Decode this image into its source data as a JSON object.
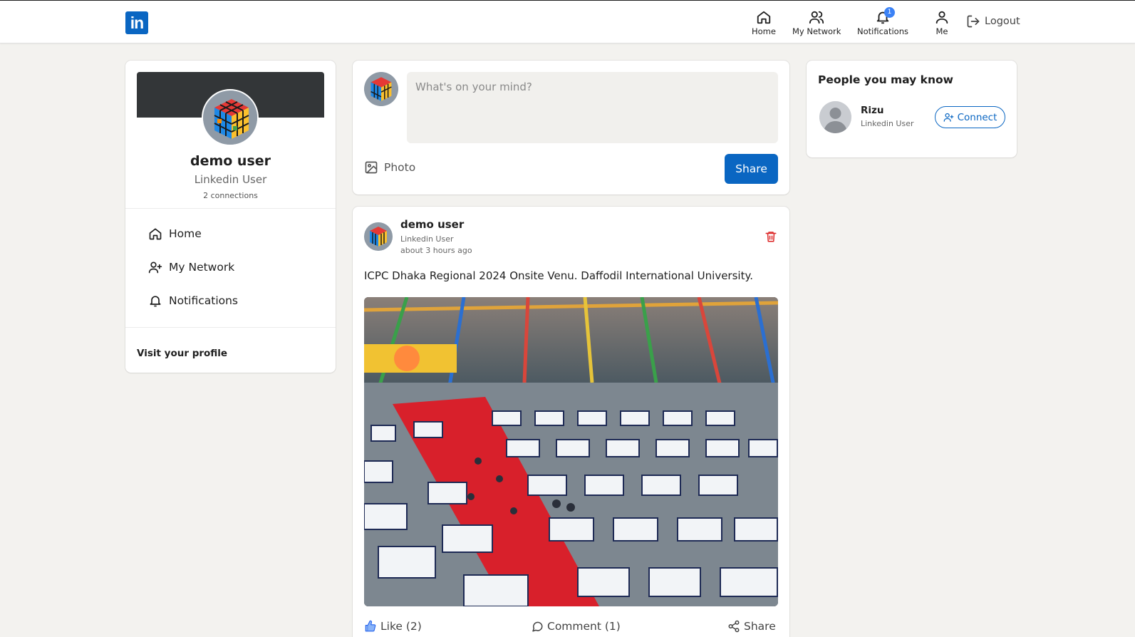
{
  "nav": {
    "logo_text": "in",
    "items": [
      {
        "label": "Home",
        "icon": "home-icon"
      },
      {
        "label": "My Network",
        "icon": "users-icon"
      },
      {
        "label": "Notifications",
        "icon": "bell-icon",
        "badge": "1"
      },
      {
        "label": "Me",
        "icon": "user-icon"
      }
    ],
    "logout_label": "Logout"
  },
  "profile": {
    "name": "demo user",
    "title": "Linkedin User",
    "connections": "2 connections",
    "links": [
      {
        "label": "Home",
        "icon": "home-icon"
      },
      {
        "label": "My Network",
        "icon": "user-plus-icon"
      },
      {
        "label": "Notifications",
        "icon": "bell-icon"
      }
    ],
    "visit_profile": "Visit your profile"
  },
  "composer": {
    "placeholder": "What's on your mind?",
    "photo_label": "Photo",
    "share_label": "Share"
  },
  "post": {
    "author": "demo user",
    "author_title": "Linkedin User",
    "timestamp": "about 3 hours ago",
    "text": "ICPC Dhaka Regional 2024 Onsite Venu. Daffodil International University.",
    "like_label": "Like (2)",
    "comment_label": "Comment (1)",
    "share_label": "Share"
  },
  "people_you_may_know": {
    "title": "People you may know",
    "people": [
      {
        "name": "Rizu",
        "title": "Linkedin User",
        "action": "Connect"
      }
    ]
  },
  "colors": {
    "brand": "#0a66c2",
    "badge": "#3b82f6",
    "delete": "#dc2626",
    "background": "#f3f2ef"
  }
}
